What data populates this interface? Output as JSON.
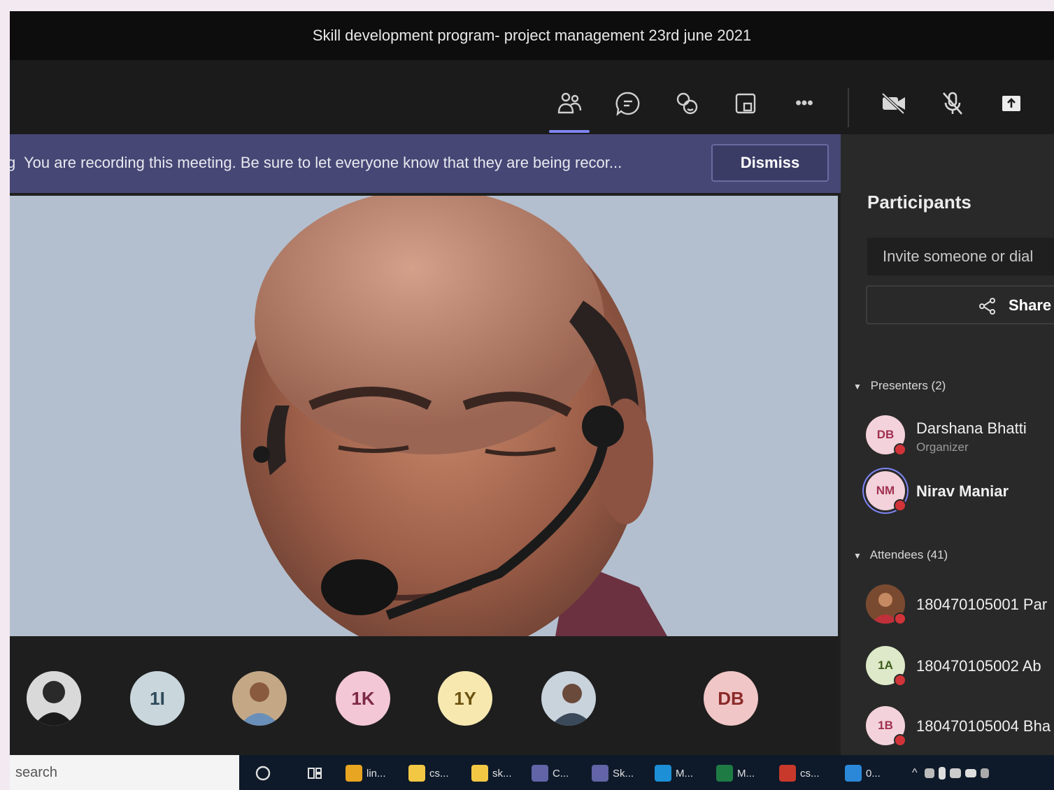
{
  "window": {
    "title": "Skill development program- project management 23rd june 2021"
  },
  "toolbar": {
    "icons": [
      "people-icon",
      "chat-icon",
      "reactions-icon",
      "room-icon",
      "more-icon",
      "camera-off-icon",
      "mic-off-icon",
      "share-tray-icon"
    ],
    "more_label": "•••"
  },
  "banner": {
    "prefix": "g",
    "text": "You are recording this meeting. Be sure to let everyone know that they are being recor...",
    "dismiss_label": "Dismiss"
  },
  "video_strip": {
    "tiles": [
      {
        "type": "photo",
        "label": ""
      },
      {
        "type": "initials",
        "label": "1I",
        "bg": "#c9d6dc",
        "fg": "#2d4a5a"
      },
      {
        "type": "photo",
        "label": ""
      },
      {
        "type": "initials",
        "label": "1K",
        "bg": "#f4c7d6",
        "fg": "#7d2a47"
      },
      {
        "type": "initials",
        "label": "1Y",
        "bg": "#f7e8b0",
        "fg": "#6b5210"
      },
      {
        "type": "photo",
        "label": ""
      },
      {
        "type": "initials",
        "label": "DB",
        "bg": "#f1c6c6",
        "fg": "#8b2a2a"
      }
    ]
  },
  "participants": {
    "title": "Participants",
    "invite_placeholder": "Invite someone or dial",
    "share_label": "Share",
    "presenters_label": "Presenters (2)",
    "attendees_label": "Attendees (41)",
    "presenters": [
      {
        "initials": "DB",
        "name": "Darshana Bhatti",
        "role": "Organizer",
        "bg": "#f3d2db",
        "fg": "#a0304f"
      },
      {
        "initials": "NM",
        "name": "Nirav Maniar",
        "role": "",
        "bg": "#f3d2db",
        "fg": "#a0304f"
      }
    ],
    "attendees": [
      {
        "initials": "",
        "name": "180470105001 Par",
        "bg": "#8a5a3a",
        "fg": "#ffffff"
      },
      {
        "initials": "1A",
        "name": "180470105002 Ab",
        "bg": "#dde9c8",
        "fg": "#3d5a1a"
      },
      {
        "initials": "1B",
        "name": "180470105004 Bha",
        "bg": "#f3d2db",
        "fg": "#a0304f"
      }
    ]
  },
  "taskbar": {
    "search_text": "search",
    "items": [
      {
        "label": "lin...",
        "color": "#e8a521"
      },
      {
        "label": "cs...",
        "color": "#f2c744"
      },
      {
        "label": "sk...",
        "color": "#f2c744"
      },
      {
        "label": "C...",
        "color": "#6264a7"
      },
      {
        "label": "Sk...",
        "color": "#6264a7"
      },
      {
        "label": "M...",
        "color": "#1d8fd6"
      },
      {
        "label": "M...",
        "color": "#1e7b44"
      },
      {
        "label": "cs...",
        "color": "#c8392b"
      },
      {
        "label": "0...",
        "color": "#2b88d8"
      }
    ]
  },
  "colors": {
    "accent": "#7f85f5",
    "banner": "#464775",
    "status_busy": "#d13438"
  }
}
